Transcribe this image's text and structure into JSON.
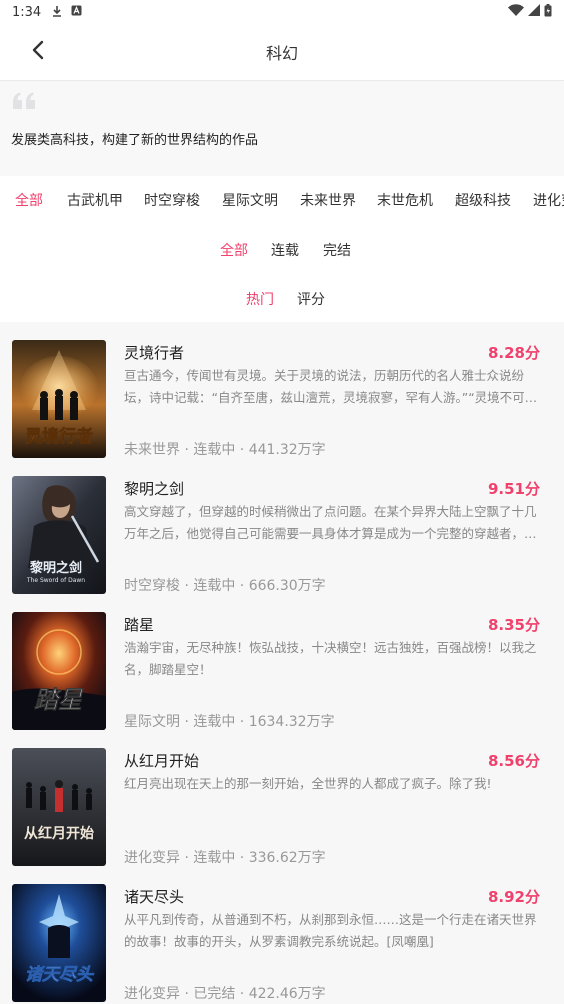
{
  "status_bar": {
    "time": "1:34"
  },
  "header": {
    "title": "科幻"
  },
  "description": "发展类高科技，构建了新的世界结构的作品",
  "tags": [
    "全部",
    "古武机甲",
    "时空穿梭",
    "星际文明",
    "未来世界",
    "末世危机",
    "超级科技",
    "进化变异"
  ],
  "status_filters": [
    "全部",
    "连载",
    "完结"
  ],
  "sort_filters": [
    "热门",
    "评分"
  ],
  "colors": {
    "accent": "#f0416c"
  },
  "books": [
    {
      "title": "灵境行者",
      "score": "8.28分",
      "description": "亘古通今，传闻世有灵境。关于灵境的说法，历朝历代的名人雅士众说纷坛，诗中记载：“自齐至唐，兹山澶荒，灵境寂寥，罕有人游。”“灵境不可…",
      "meta": "未来世界 · 连载中 · 441.32万字",
      "cover_text": "灵境行者"
    },
    {
      "title": "黎明之剑",
      "score": "9.51分",
      "description": "高文穿越了，但穿越的时候稍微出了点问题。在某个异界大陆上空飘了十几万年之后，他觉得自己可能需要一具身体才算是成为一个完整的穿越者，…",
      "meta": "时空穿梭 · 连载中 · 666.30万字",
      "cover_text": "黎明之剑",
      "cover_subtext": "The Sword of Dawn"
    },
    {
      "title": "踏星",
      "score": "8.35分",
      "description": "浩瀚宇宙，无尽种族！恢弘战技，十决横空！远古独姓，百强战榜！以我之名，脚踏星空！",
      "meta": "星际文明 · 连载中 · 1634.32万字",
      "cover_text": "踏星"
    },
    {
      "title": "从红月开始",
      "score": "8.56分",
      "description": "红月亮出现在天上的那一刻开始，全世界的人都成了疯子。除了我!",
      "meta": "进化变异 · 连载中 · 336.62万字",
      "cover_text": "从红月开始"
    },
    {
      "title": "诸天尽头",
      "score": "8.92分",
      "description": "从平凡到传奇，从普通到不朽，从刹那到永恒……这是一个行走在诸天世界的故事！故事的开头，从罗素调教完系统说起。[凤嘲凰]",
      "meta": "进化变异 · 已完结 · 422.46万字",
      "cover_text": "诸天尽头"
    }
  ]
}
